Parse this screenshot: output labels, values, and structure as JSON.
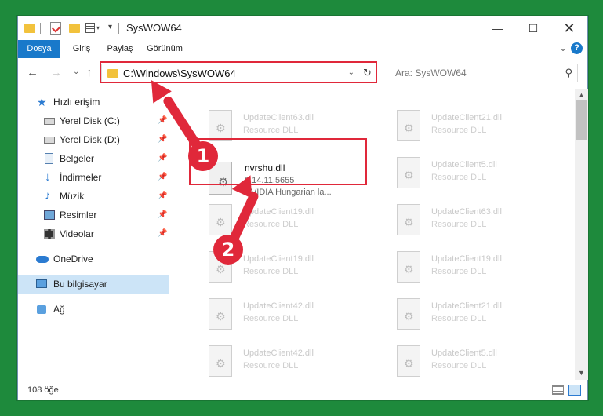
{
  "window": {
    "title": "SysWOW64",
    "min_symbol": "—",
    "max_symbol": "☐",
    "close_symbol": "✕"
  },
  "ribbon": {
    "tabs": [
      "Dosya",
      "Giriş",
      "Paylaş",
      "Görünüm"
    ],
    "expand_symbol": "⌄",
    "help_symbol": "?"
  },
  "nav": {
    "back_symbol": "←",
    "forward_symbol": "→",
    "recent_symbol": "⌄",
    "up_symbol": "↑",
    "address_path": "C:\\Windows\\SysWOW64",
    "address_dropdown_symbol": "⌄",
    "refresh_symbol": "↻",
    "search_placeholder": "Ara: SysWOW64",
    "search_icon_symbol": "⚲"
  },
  "sidebar": {
    "items": [
      {
        "label": "Hızlı erişim",
        "icon": "star-icon",
        "pinned": false
      },
      {
        "label": "Yerel Disk (C:)",
        "icon": "drive-icon",
        "pinned": true
      },
      {
        "label": "Yerel Disk (D:)",
        "icon": "drive-icon",
        "pinned": true
      },
      {
        "label": "Belgeler",
        "icon": "documents-icon",
        "pinned": true
      },
      {
        "label": "İndirmeler",
        "icon": "download-icon",
        "pinned": true
      },
      {
        "label": "Müzik",
        "icon": "music-icon",
        "pinned": true
      },
      {
        "label": "Resimler",
        "icon": "pictures-icon",
        "pinned": true
      },
      {
        "label": "Videolar",
        "icon": "videos-icon",
        "pinned": true
      },
      {
        "label": "OneDrive",
        "icon": "cloud-icon",
        "pinned": false
      },
      {
        "label": "Bu bilgisayar",
        "icon": "computer-icon",
        "pinned": false,
        "selected": true
      },
      {
        "label": "Ağ",
        "icon": "network-icon",
        "pinned": false
      }
    ],
    "pin_symbol": "📌"
  },
  "files": {
    "left_column": [
      {
        "name": "UpdateClient63.dll",
        "type": "Resource DLL"
      },
      {
        "name": "UpdateClient19.dll",
        "type": "Resource DLL"
      },
      {
        "name": "UpdateClient19.dll",
        "type": "Resource DLL"
      },
      {
        "name": "UpdateClient42.dll",
        "type": "Resource DLL"
      },
      {
        "name": "UpdateClient42.dll",
        "type": "Resource DLL"
      }
    ],
    "right_column": [
      {
        "name": "UpdateClient21.dll",
        "type": "Resource DLL"
      },
      {
        "name": "UpdateClient5.dll",
        "type": "Resource DLL"
      },
      {
        "name": "UpdateClient63.dll",
        "type": "Resource DLL"
      },
      {
        "name": "UpdateClient19.dll",
        "type": "Resource DLL"
      },
      {
        "name": "UpdateClient21.dll",
        "type": "Resource DLL"
      },
      {
        "name": "UpdateClient5.dll",
        "type": "Resource DLL"
      }
    ],
    "highlighted": {
      "name": "nvrshu.dll",
      "version": "6.14.11.5655",
      "description": "NVIDIA Hungarian la..."
    }
  },
  "status": {
    "item_count": "108 öğe"
  },
  "annotations": {
    "badge1": "1",
    "badge2": "2",
    "color": "#e0283a"
  },
  "colors": {
    "accent": "#1979ca",
    "selection": "#cce4f7",
    "background": "#1e8a3c"
  }
}
